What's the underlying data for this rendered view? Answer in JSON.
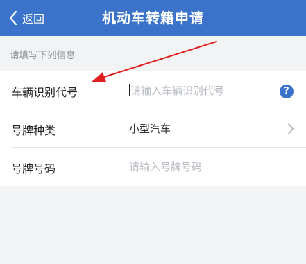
{
  "header": {
    "back_label": "返回",
    "title": "机动车转籍申请",
    "bar_color": "#3a73c9"
  },
  "hint": {
    "text": "请填写下列信息"
  },
  "form": {
    "rows": [
      {
        "label": "车辆识别代号",
        "placeholder": "请输入车辆识别代号",
        "trailing_icon": "help-icon"
      },
      {
        "label": "号牌种类",
        "value": "小型汽车",
        "trailing_icon": "chevron-right-icon"
      },
      {
        "label": "号牌号码",
        "placeholder": "请输入号牌号码"
      }
    ]
  },
  "help_icon_text": "?",
  "annotation": {
    "color": "#e02020",
    "icon": "red-arrow-annotation"
  }
}
